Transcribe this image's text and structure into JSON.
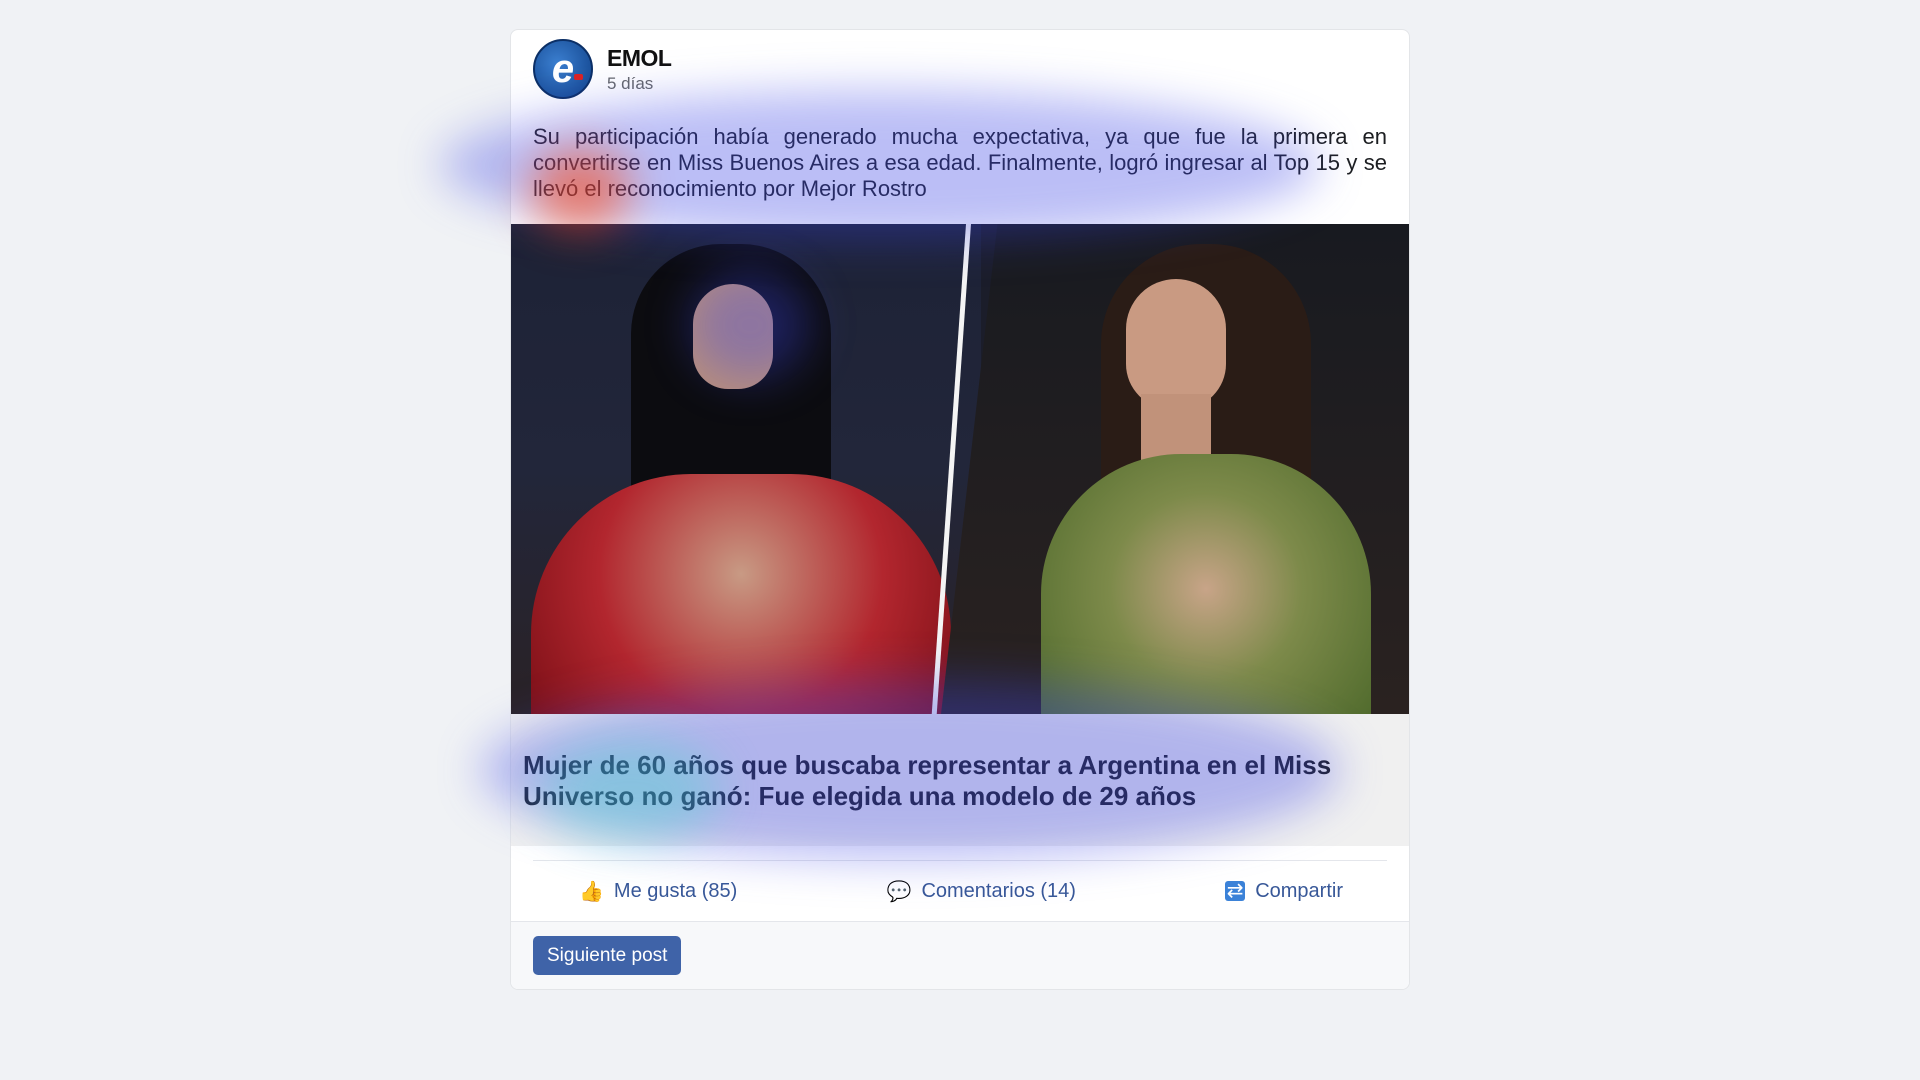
{
  "post": {
    "page_name": "EMOL",
    "timestamp": "5 días",
    "avatar_letter": "e",
    "text": "Su participación había generado mucha expectativa, ya que fue la primera en convertirse en Miss Buenos Aires a esa edad. Finalmente, logró ingresar al Top 15 y se llevó el reconocimiento por Mejor Rostro",
    "link_title": "Mujer de 60 años que buscaba representar a Argentina en el Miss Universo no ganó: Fue elegida una modelo de 29 años"
  },
  "actions": {
    "like": {
      "label": "Me gusta (85)",
      "icon": "thumbs-up-icon"
    },
    "comment": {
      "label": "Comentarios (14)",
      "icon": "speech-bubble-icon"
    },
    "share": {
      "label": "Compartir",
      "icon": "share-icon"
    }
  },
  "footer": {
    "next_label": "Siguiente post"
  },
  "colors": {
    "link_blue": "#385898",
    "button_blue": "#3f63a8",
    "background": "#f0f2f5"
  }
}
